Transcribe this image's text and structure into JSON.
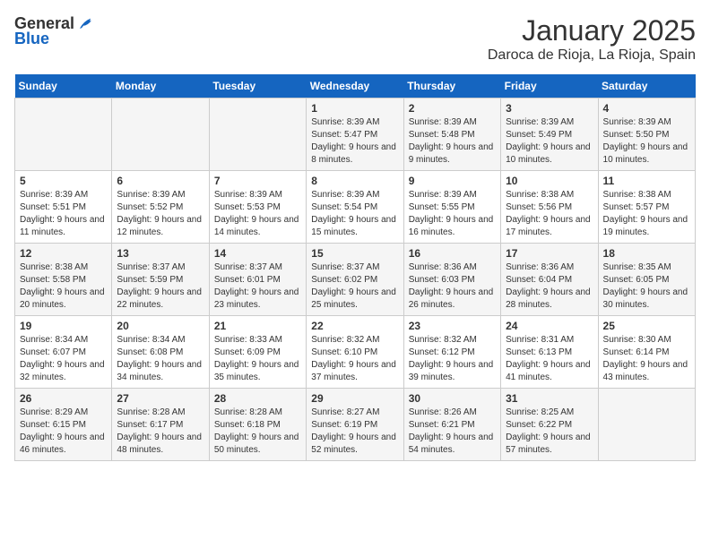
{
  "logo": {
    "general": "General",
    "blue": "Blue"
  },
  "title": "January 2025",
  "subtitle": "Daroca de Rioja, La Rioja, Spain",
  "days_of_week": [
    "Sunday",
    "Monday",
    "Tuesday",
    "Wednesday",
    "Thursday",
    "Friday",
    "Saturday"
  ],
  "weeks": [
    [
      {
        "day": "",
        "detail": ""
      },
      {
        "day": "",
        "detail": ""
      },
      {
        "day": "",
        "detail": ""
      },
      {
        "day": "1",
        "detail": "Sunrise: 8:39 AM\nSunset: 5:47 PM\nDaylight: 9 hours and 8 minutes."
      },
      {
        "day": "2",
        "detail": "Sunrise: 8:39 AM\nSunset: 5:48 PM\nDaylight: 9 hours and 9 minutes."
      },
      {
        "day": "3",
        "detail": "Sunrise: 8:39 AM\nSunset: 5:49 PM\nDaylight: 9 hours and 10 minutes."
      },
      {
        "day": "4",
        "detail": "Sunrise: 8:39 AM\nSunset: 5:50 PM\nDaylight: 9 hours and 10 minutes."
      }
    ],
    [
      {
        "day": "5",
        "detail": "Sunrise: 8:39 AM\nSunset: 5:51 PM\nDaylight: 9 hours and 11 minutes."
      },
      {
        "day": "6",
        "detail": "Sunrise: 8:39 AM\nSunset: 5:52 PM\nDaylight: 9 hours and 12 minutes."
      },
      {
        "day": "7",
        "detail": "Sunrise: 8:39 AM\nSunset: 5:53 PM\nDaylight: 9 hours and 14 minutes."
      },
      {
        "day": "8",
        "detail": "Sunrise: 8:39 AM\nSunset: 5:54 PM\nDaylight: 9 hours and 15 minutes."
      },
      {
        "day": "9",
        "detail": "Sunrise: 8:39 AM\nSunset: 5:55 PM\nDaylight: 9 hours and 16 minutes."
      },
      {
        "day": "10",
        "detail": "Sunrise: 8:38 AM\nSunset: 5:56 PM\nDaylight: 9 hours and 17 minutes."
      },
      {
        "day": "11",
        "detail": "Sunrise: 8:38 AM\nSunset: 5:57 PM\nDaylight: 9 hours and 19 minutes."
      }
    ],
    [
      {
        "day": "12",
        "detail": "Sunrise: 8:38 AM\nSunset: 5:58 PM\nDaylight: 9 hours and 20 minutes."
      },
      {
        "day": "13",
        "detail": "Sunrise: 8:37 AM\nSunset: 5:59 PM\nDaylight: 9 hours and 22 minutes."
      },
      {
        "day": "14",
        "detail": "Sunrise: 8:37 AM\nSunset: 6:01 PM\nDaylight: 9 hours and 23 minutes."
      },
      {
        "day": "15",
        "detail": "Sunrise: 8:37 AM\nSunset: 6:02 PM\nDaylight: 9 hours and 25 minutes."
      },
      {
        "day": "16",
        "detail": "Sunrise: 8:36 AM\nSunset: 6:03 PM\nDaylight: 9 hours and 26 minutes."
      },
      {
        "day": "17",
        "detail": "Sunrise: 8:36 AM\nSunset: 6:04 PM\nDaylight: 9 hours and 28 minutes."
      },
      {
        "day": "18",
        "detail": "Sunrise: 8:35 AM\nSunset: 6:05 PM\nDaylight: 9 hours and 30 minutes."
      }
    ],
    [
      {
        "day": "19",
        "detail": "Sunrise: 8:34 AM\nSunset: 6:07 PM\nDaylight: 9 hours and 32 minutes."
      },
      {
        "day": "20",
        "detail": "Sunrise: 8:34 AM\nSunset: 6:08 PM\nDaylight: 9 hours and 34 minutes."
      },
      {
        "day": "21",
        "detail": "Sunrise: 8:33 AM\nSunset: 6:09 PM\nDaylight: 9 hours and 35 minutes."
      },
      {
        "day": "22",
        "detail": "Sunrise: 8:32 AM\nSunset: 6:10 PM\nDaylight: 9 hours and 37 minutes."
      },
      {
        "day": "23",
        "detail": "Sunrise: 8:32 AM\nSunset: 6:12 PM\nDaylight: 9 hours and 39 minutes."
      },
      {
        "day": "24",
        "detail": "Sunrise: 8:31 AM\nSunset: 6:13 PM\nDaylight: 9 hours and 41 minutes."
      },
      {
        "day": "25",
        "detail": "Sunrise: 8:30 AM\nSunset: 6:14 PM\nDaylight: 9 hours and 43 minutes."
      }
    ],
    [
      {
        "day": "26",
        "detail": "Sunrise: 8:29 AM\nSunset: 6:15 PM\nDaylight: 9 hours and 46 minutes."
      },
      {
        "day": "27",
        "detail": "Sunrise: 8:28 AM\nSunset: 6:17 PM\nDaylight: 9 hours and 48 minutes."
      },
      {
        "day": "28",
        "detail": "Sunrise: 8:28 AM\nSunset: 6:18 PM\nDaylight: 9 hours and 50 minutes."
      },
      {
        "day": "29",
        "detail": "Sunrise: 8:27 AM\nSunset: 6:19 PM\nDaylight: 9 hours and 52 minutes."
      },
      {
        "day": "30",
        "detail": "Sunrise: 8:26 AM\nSunset: 6:21 PM\nDaylight: 9 hours and 54 minutes."
      },
      {
        "day": "31",
        "detail": "Sunrise: 8:25 AM\nSunset: 6:22 PM\nDaylight: 9 hours and 57 minutes."
      },
      {
        "day": "",
        "detail": ""
      }
    ]
  ]
}
